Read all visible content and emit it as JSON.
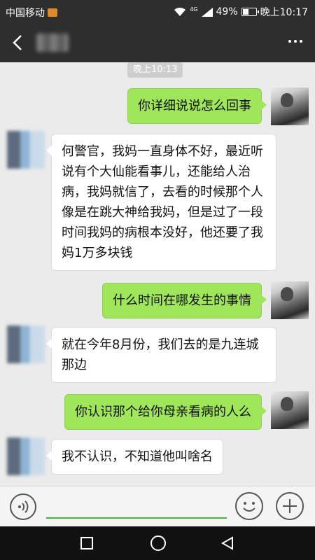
{
  "status_bar": {
    "carrier": "中国移动",
    "network": "4G",
    "battery_percent": "49%",
    "battery_level": 0.49,
    "time": "晚上10:17"
  },
  "title_bar": {
    "back_icon": "chevron-left-icon",
    "more_icon": "more-dots-icon"
  },
  "chat": {
    "timestamp": "晚上10:13",
    "messages": [
      {
        "sender": "me",
        "text": "你详细说说怎么回事"
      },
      {
        "sender": "other",
        "text": "何警官，我妈一直身体不好，最近听说有个大仙能看事儿，还能给人治病，我妈就信了，去看的时候那个人像是在跳大神给我妈，但是过了一段时间我妈的病根本没好，他还要了我妈1万多块钱"
      },
      {
        "sender": "me",
        "text": "什么时间在哪发生的事情"
      },
      {
        "sender": "other",
        "text": "就在今年8月份，我们去的是九连城那边"
      },
      {
        "sender": "me",
        "text": "你认识那个给你母亲看病的人么"
      },
      {
        "sender": "other",
        "text": "我不认识，不知道他叫啥名"
      }
    ]
  },
  "input_bar": {
    "voice_icon": "voice-icon",
    "emoji_icon": "smile-icon",
    "add_icon": "plus-icon",
    "input_value": "",
    "accent_color": "#3fb838"
  },
  "colors": {
    "my_bubble": "#9fe65a",
    "other_bubble": "#ffffff",
    "bars": "#2e2e2e"
  }
}
